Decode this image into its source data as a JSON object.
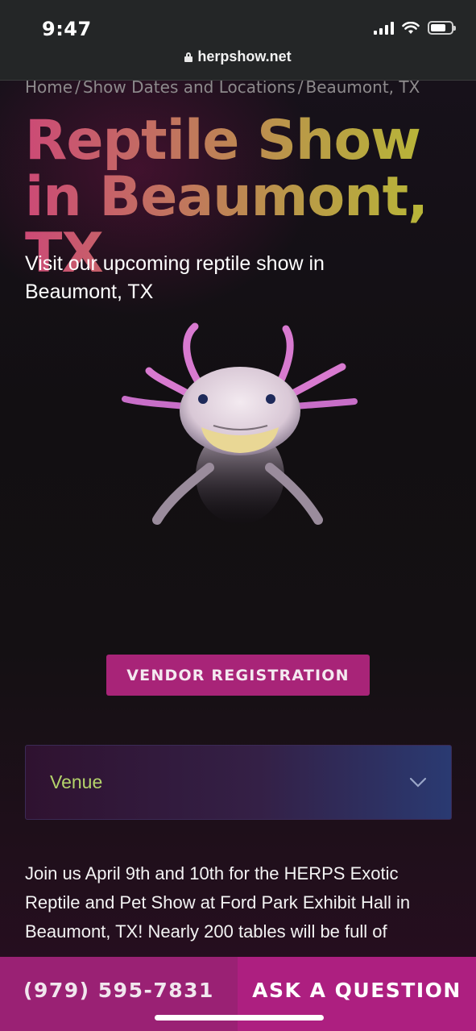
{
  "status_bar": {
    "time": "9:47",
    "url": "herpshow.net"
  },
  "breadcrumb": {
    "items": [
      "Home",
      "Show Dates and Locations",
      "Beaumont, TX"
    ],
    "separator": "/"
  },
  "hero": {
    "title": "Reptile Show in Beaumont, TX",
    "subtitle": "Visit our upcoming reptile show in Beaumont, TX",
    "image_icon": "axolotl-image"
  },
  "vendor_button": {
    "label": "VENDOR REGISTRATION"
  },
  "venue_accordion": {
    "label": "Venue",
    "icon": "chevron-down-icon"
  },
  "body": {
    "paragraph": "Join us April 9th and 10th for the HERPS Exotic Reptile and Pet Show at Ford Park Exhibit Hall in Beaumont, TX! Nearly 200 tables will be full of"
  },
  "bottom_bar": {
    "phone_label": "(979) 595-7831",
    "ask_label": "ASK A QUESTION"
  },
  "colors": {
    "accent": "#a82478",
    "venue_text": "#b4d36b",
    "title_gradient_start": "#cc4a76",
    "title_gradient_end": "#b7bd34"
  }
}
